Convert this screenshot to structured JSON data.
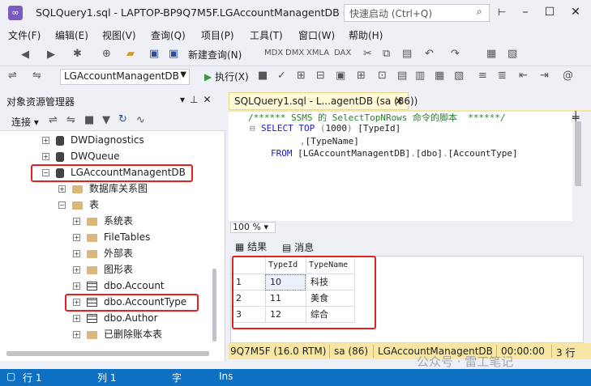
{
  "window": {
    "title": "SQLQuery1.sql - LAPTOP-BP9Q7M5F.LGAccountManagentDB (s...",
    "quick_launch_placeholder": "快速启动 (Ctrl+Q)"
  },
  "menu": [
    "文件(F)",
    "编辑(E)",
    "视图(V)",
    "查询(Q)",
    "项目(P)",
    "工具(T)",
    "窗口(W)",
    "帮助(H)"
  ],
  "toolbar": {
    "new_query_label": "新建查询(N)",
    "database_combo": "LGAccountManagentDB",
    "execute_label": "执行(X)"
  },
  "object_explorer": {
    "title": "对象资源管理器",
    "connect_label": "连接",
    "tree": [
      {
        "label": "DWDiagnostics",
        "kind": "database"
      },
      {
        "label": "DWQueue",
        "kind": "database"
      },
      {
        "label": "LGAccountManagentDB",
        "kind": "database",
        "highlighted": true
      },
      {
        "label": "数据库关系图",
        "kind": "folder"
      },
      {
        "label": "表",
        "kind": "folder"
      },
      {
        "label": "系统表",
        "kind": "folder"
      },
      {
        "label": "FileTables",
        "kind": "folder"
      },
      {
        "label": "外部表",
        "kind": "folder"
      },
      {
        "label": "图形表",
        "kind": "folder"
      },
      {
        "label": "dbo.Account",
        "kind": "table"
      },
      {
        "label": "dbo.AccountType",
        "kind": "table",
        "highlighted": true
      },
      {
        "label": "dbo.Author",
        "kind": "table"
      },
      {
        "label": "已删除账本表",
        "kind": "folder"
      }
    ]
  },
  "editor": {
    "tab_label": "SQLQuery1.sql - L...agentDB (sa (86))",
    "lines": [
      "/****** SSMS 的 SelectTopNRows 命令的脚本  ******/",
      "SELECT TOP (1000) [TypeId]",
      ",[TypeName]",
      "FROM [LGAccountManagentDB].[dbo].[AccountType]"
    ],
    "zoom": "100 %"
  },
  "results": {
    "tab_results": "结果",
    "tab_messages": "消息",
    "columns": [
      "TypeId",
      "TypeName"
    ],
    "rows": [
      {
        "num": "1",
        "TypeId": "10",
        "TypeName": "科技"
      },
      {
        "num": "2",
        "TypeId": "11",
        "TypeName": "美食"
      },
      {
        "num": "3",
        "TypeId": "12",
        "TypeName": "综合"
      }
    ]
  },
  "query_status": {
    "server": "9Q7M5F (16.0 RTM)",
    "user": "sa (86)",
    "database": "LGAccountManagentDB",
    "elapsed": "00:00:00",
    "rows": "3 行"
  },
  "status_bar": {
    "line": "行 1",
    "col": "列 1",
    "char": "字",
    "mode": "Ins"
  },
  "watermark": "公众号 · 雷工笔记",
  "colors": {
    "accent": "#0e70c0",
    "highlight_box": "#e52020",
    "query_status_bg": "#f8e7a4"
  }
}
